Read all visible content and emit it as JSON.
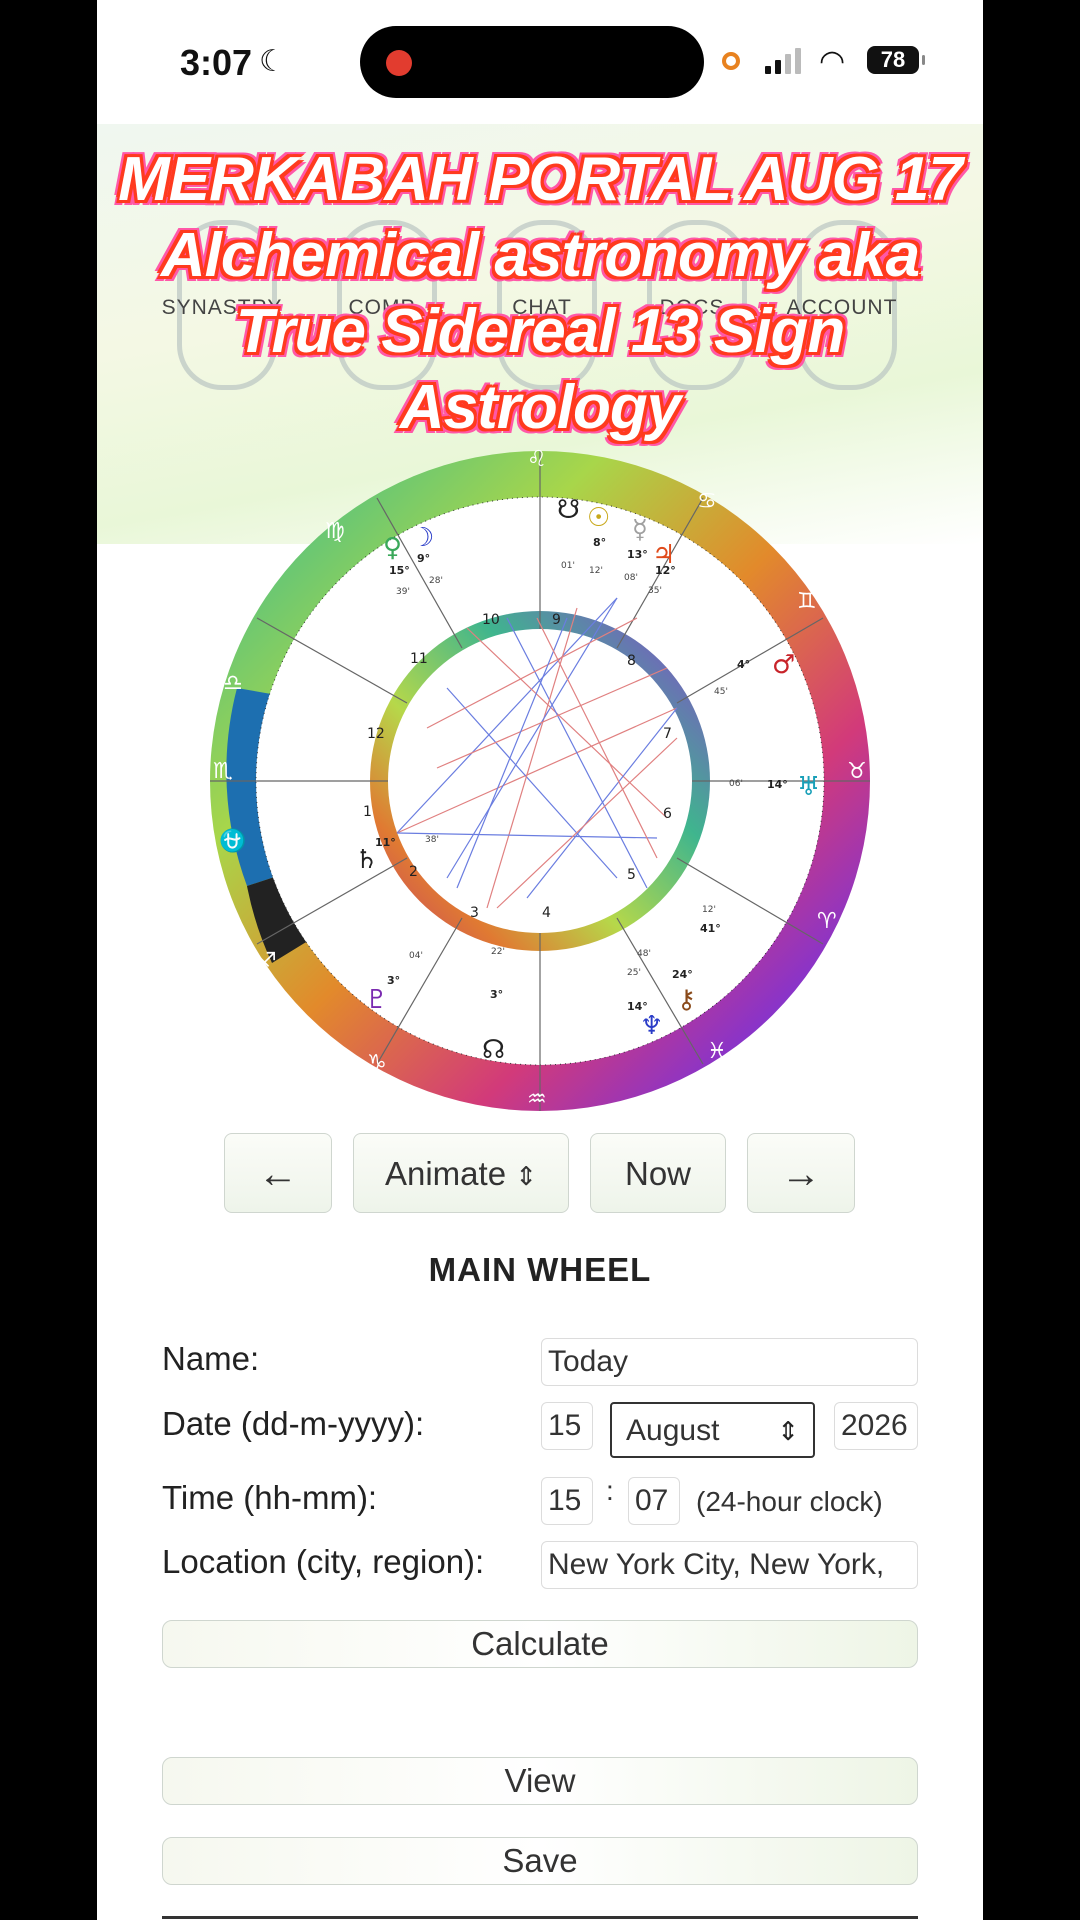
{
  "status_bar": {
    "time": "3:07",
    "battery": "78",
    "moon_icon": "moon-icon",
    "wifi_icon": "wifi-icon"
  },
  "nav": {
    "items": [
      "SYNASTRY",
      "COMP",
      "CHAT",
      "DOCS",
      "ACCOUNT"
    ]
  },
  "overlay": {
    "line1": "MERKABAH PORTAL AUG 17",
    "line2": "Alchemical astronomy aka",
    "line3": "True Sidereal 13 Sign",
    "line4": "Astrology",
    "colors": {
      "fill": "#ffffff",
      "stroke": "#ff3b1f",
      "glow": "#ff58a8"
    }
  },
  "chart_wheel": {
    "houses": [
      "1",
      "2",
      "3",
      "4",
      "5",
      "6",
      "7",
      "8",
      "9",
      "10",
      "11",
      "12"
    ],
    "planet_labels": [
      "15°",
      "9°",
      "8°",
      "13°",
      "12°",
      "4°",
      "14°",
      "11°",
      "3°",
      "3°",
      "14°",
      "24°",
      "41°"
    ],
    "minute_labels": [
      "01'",
      "12'",
      "08'",
      "35'",
      "39'",
      "28'",
      "45'",
      "06'",
      "38'",
      "04'",
      "22'",
      "48'",
      "25'",
      "12'"
    ]
  },
  "controls": {
    "prev_icon": "arrow-left-icon",
    "animate": "Animate",
    "now": "Now",
    "next_icon": "arrow-right-icon"
  },
  "form": {
    "title": "MAIN WHEEL",
    "name_label": "Name:",
    "name_value": "Today",
    "date_label": "Date (dd-m-yyyy):",
    "day": "15",
    "month": "August",
    "year": "2026",
    "time_label": "Time (hh-mm):",
    "hour": "15",
    "time_sep": ":",
    "minute": "07",
    "clock_hint": "(24-hour clock)",
    "location_label": "Location (city, region):",
    "location_value": "New York City, New York,",
    "calculate": "Calculate",
    "view": "View",
    "save": "Save"
  }
}
